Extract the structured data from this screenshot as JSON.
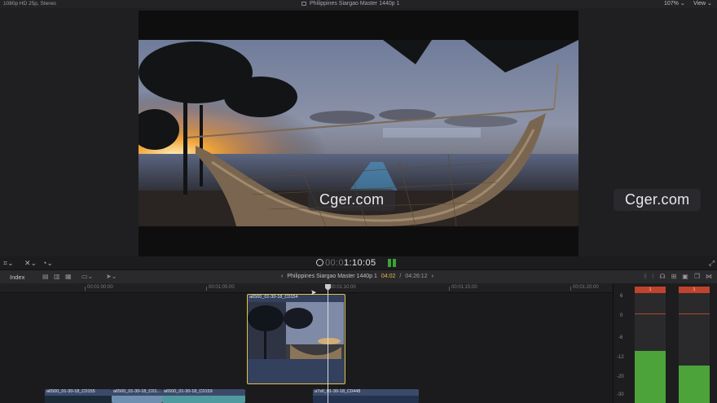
{
  "top_bar": {
    "format": "1080p HD 25p, Stereo",
    "project_title": "Philippines Siargao Master 1440p 1",
    "zoom": "107%",
    "zoom_chevron": "⌄",
    "view_label": "View",
    "view_chevron": "⌄"
  },
  "viewer": {
    "watermark": "Cger.com",
    "watermark_side": "Cger.com"
  },
  "playback": {
    "timecode_dim": "00:0",
    "timecode": "1:10:05"
  },
  "timeline_toolbar": {
    "index_label": "Index",
    "back_arrow": "‹",
    "project_title": "Philippines Siargao Master 1440p 1",
    "current_time": "04:02",
    "separator": "/",
    "total_time": "04:26:12",
    "forward_arrow": "›"
  },
  "ruler": {
    "ticks": [
      "00:01:00:00",
      "00:01:05:00",
      "00:01:10:00",
      "00:01:15:00",
      "00:01:20:00"
    ]
  },
  "clips": {
    "selected": "a6500_01-30-18_C0154",
    "bottom": [
      "a6500_01-30-18_C0155",
      "a6500_01-30-18_C01...",
      "a6500_01-30-18_C0159",
      "a7sII_01-30-18_C0448"
    ]
  },
  "audio_meters": {
    "scale": [
      "6",
      "0",
      "-6",
      "-12",
      "-20",
      "-30"
    ],
    "peak_left": "1",
    "peak_right": "1",
    "levels": [
      0.45,
      0.32
    ]
  },
  "colors": {
    "accent_yellow": "#e3c24a",
    "meter_green": "#4ca33a",
    "meter_peak_red": "#c0432d",
    "clip_blue": "#3c4a6a"
  }
}
